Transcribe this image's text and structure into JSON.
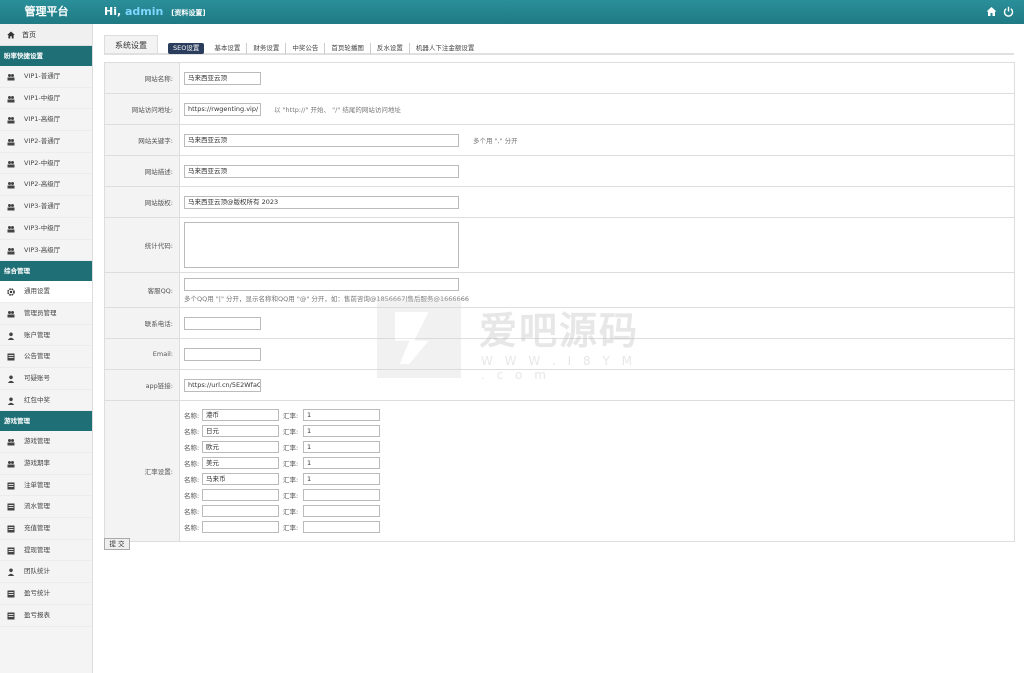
{
  "header": {
    "brand": "管理平台",
    "greeting": "Hi,",
    "username": "admin",
    "profile_link": "[资料设置]"
  },
  "sidebar": {
    "home": "首页",
    "groups": [
      {
        "title": "盼率快捷设置",
        "items": [
          "VIP1-普通厅",
          "VIP1-中级厅",
          "VIP1-高级厅",
          "VIP2-普通厅",
          "VIP2-中级厅",
          "VIP2-高级厅",
          "VIP3-普通厅",
          "VIP3-中级厅",
          "VIP3-高级厅"
        ]
      },
      {
        "title": "综合管理",
        "items": [
          "通用设置",
          "管理员管理",
          "账户管理",
          "公告管理",
          "可疑账号",
          "红包中奖"
        ]
      },
      {
        "title": "游戏管理",
        "items": [
          "游戏管理",
          "游戏期率",
          "注单管理",
          "流水管理",
          "充值管理",
          "提现管理",
          "团队统计",
          "盈亏统计",
          "盈亏报表"
        ]
      }
    ]
  },
  "tabs": {
    "main": "系统设置",
    "sub": [
      "SEO设置",
      "基本设置",
      "财务设置",
      "中奖公告",
      "首页轮播图",
      "反水设置",
      "机器人下注金额设置"
    ]
  },
  "form": {
    "site_name": {
      "label": "网站名称:",
      "value": "马来西亚云顶"
    },
    "site_url": {
      "label": "网站访问地址:",
      "value": "https://rwgenting.vip/",
      "tip": "以 \"http://\" 开始、 \"/\" 结尾的网站访问地址"
    },
    "keywords": {
      "label": "网站关键字:",
      "value": "马来西亚云顶",
      "tip": "多个用 \",\" 分开"
    },
    "description": {
      "label": "网站描述:",
      "value": "马来西亚云顶"
    },
    "copyright": {
      "label": "网站版权:",
      "value": "马来西亚云顶@版权所有 2023"
    },
    "stats_code": {
      "label": "统计代码:"
    },
    "service_qq": {
      "label": "客服QQ:",
      "value": "",
      "tip": "多个QQ用 \"|\" 分开，显示名称和QQ用 \"@\" 分开，如：售前咨询@1856667|售后服务@1666666"
    },
    "phone": {
      "label": "联系电话:",
      "value": ""
    },
    "email": {
      "label": "Email:",
      "value": ""
    },
    "app_link": {
      "label": "app链接:",
      "value": "https://url.cn/5E2WfaQ"
    },
    "rates": {
      "label": "汇率设置:",
      "name_label": "名称:",
      "rate_label": "汇率:",
      "rows": [
        {
          "name": "港币",
          "rate": "1"
        },
        {
          "name": "日元",
          "rate": "1"
        },
        {
          "name": "欧元",
          "rate": "1"
        },
        {
          "name": "美元",
          "rate": "1"
        },
        {
          "name": "马来币",
          "rate": "1"
        },
        {
          "name": "",
          "rate": ""
        },
        {
          "name": "",
          "rate": ""
        },
        {
          "name": "",
          "rate": ""
        }
      ]
    }
  },
  "submit_label": "提 交",
  "watermark": {
    "text": "爱吧源码",
    "url": "W W W . I 8 Y M . c o m"
  }
}
